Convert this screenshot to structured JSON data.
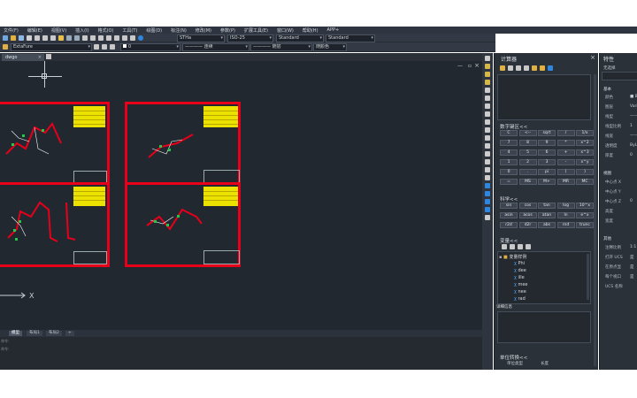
{
  "menu": [
    "文件(F)",
    "编辑(E)",
    "视图(V)",
    "插入(I)",
    "格式(O)",
    "工具(T)",
    "绘图(D)",
    "标注(N)",
    "修改(M)",
    "参数(P)",
    "扩展工具(E)",
    "窗口(W)",
    "帮助(H)",
    "APP+"
  ],
  "toolbar": {
    "text_style_combo": "STHa",
    "dim_style_combo": "ISO-25",
    "table_style_combo": "Standard",
    "mleader_style_combo": "Standard",
    "layer_combo": "ExtaFure",
    "color_combo": "0",
    "linetype_combo": "———— 连续",
    "lineweight_combo": "———— 随层",
    "plotstyle_combo": "随颜色"
  },
  "doc_tab": {
    "name": "dwgo"
  },
  "layout_tabs": [
    "模型",
    "布局1",
    "布局2",
    "+"
  ],
  "cmd_lines": [
    "命令:",
    "命令:"
  ],
  "calc": {
    "title": "计算器",
    "numpad_title": "数字键区<<",
    "keypad": [
      [
        "C",
        "<--",
        "sqrt",
        "/",
        "1/x"
      ],
      [
        "7",
        "8",
        "9",
        "*",
        "x^2"
      ],
      [
        "4",
        "5",
        "6",
        "+",
        "x^3"
      ],
      [
        "1",
        "2",
        "3",
        "-",
        "x^y"
      ],
      [
        "0",
        ".",
        "pi",
        "(",
        ")"
      ],
      [
        "=",
        "MS",
        "M+",
        "MR",
        "MC"
      ]
    ],
    "sci_title": "科学<<",
    "sci_keys": [
      [
        "sin",
        "cos",
        "tan",
        "log",
        "10^x"
      ],
      [
        "asin",
        "acos",
        "atan",
        "ln",
        "e^x"
      ],
      [
        "r2d",
        "d2r",
        "abs",
        "rnd",
        "trunc"
      ]
    ],
    "vars_title": "变量<<",
    "var_folder": "变量样例",
    "vars": [
      "Phi",
      "dee",
      "ille",
      "mee",
      "nee",
      "rad"
    ],
    "details_label": "详细信息",
    "unit_title": "单位转换<<",
    "unit_type_label": "单位类型",
    "unit_type_value": "长度"
  },
  "props": {
    "title": "特性",
    "selection": "无选择",
    "basic_title": "基本",
    "basic": [
      {
        "label": "颜色",
        "value": "■ ByLayer"
      },
      {
        "label": "图层",
        "value": "Vari"
      },
      {
        "label": "线型",
        "value": "——"
      },
      {
        "label": "线型比例",
        "value": "1"
      },
      {
        "label": "线宽",
        "value": "——"
      },
      {
        "label": "透明度",
        "value": "ByL"
      },
      {
        "label": "厚度",
        "value": "0"
      }
    ],
    "view_title": "视图",
    "view": [
      {
        "label": "中心点 X",
        "value": ""
      },
      {
        "label": "中心点 Y",
        "value": ""
      },
      {
        "label": "中心点 Z",
        "value": "0"
      },
      {
        "label": "高度",
        "value": ""
      },
      {
        "label": "宽度",
        "value": ""
      }
    ],
    "misc_title": "其他",
    "misc": [
      {
        "label": "注释比例",
        "value": "1:1"
      },
      {
        "label": "打开 UCS",
        "value": "是"
      },
      {
        "label": "在原点显",
        "value": "是"
      },
      {
        "label": "每个视口",
        "value": "是"
      },
      {
        "label": "UCS 名称",
        "value": ""
      }
    ]
  },
  "colors": {
    "frame": "#e8001a",
    "title_block": "#ece200",
    "canvas": "#212830",
    "accent": "#2e86de"
  }
}
